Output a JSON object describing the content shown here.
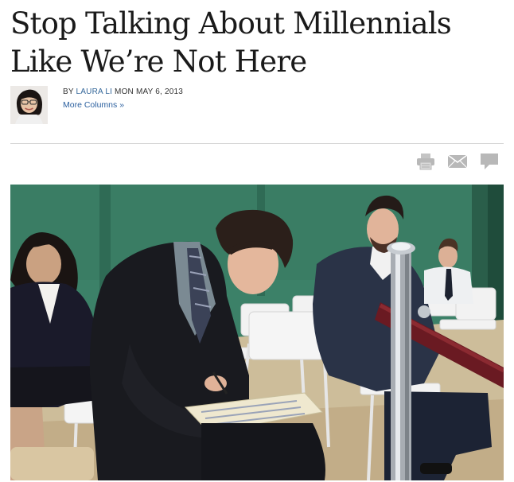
{
  "article": {
    "headline": "Stop Talking About Millennials Like We’re Not Here",
    "byline": {
      "prefix": "BY",
      "author": "LAURA LI",
      "date": "MON MAY 6, 2013",
      "more_columns": "More Columns »"
    }
  },
  "tools": [
    {
      "name": "print-icon"
    },
    {
      "name": "email-icon"
    },
    {
      "name": "comment-icon"
    }
  ],
  "colors": {
    "link": "#336699",
    "icon_gray": "#b8b8b8",
    "divider": "#d4d4d4",
    "photo_wall": "#3c8168"
  }
}
